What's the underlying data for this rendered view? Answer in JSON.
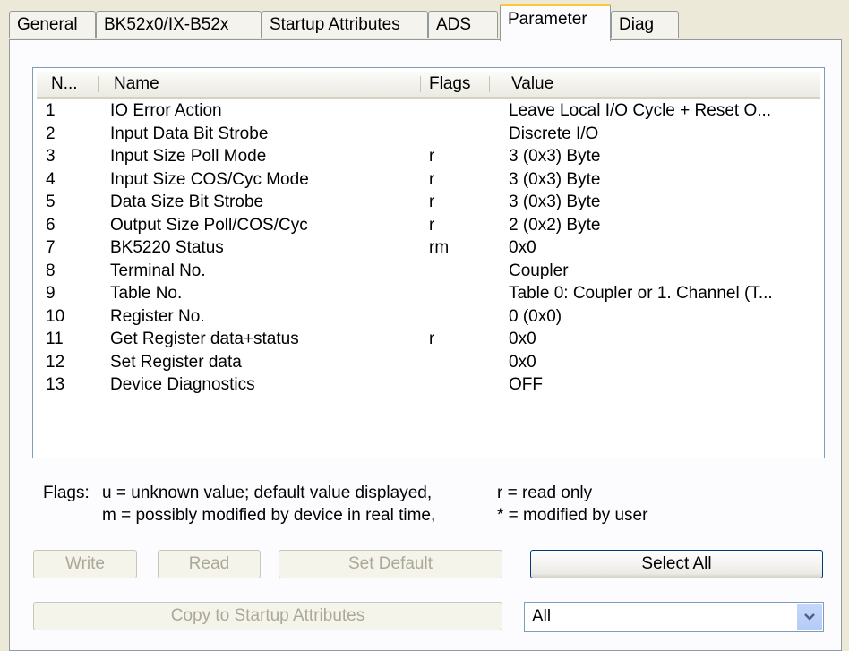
{
  "tabs": [
    "General",
    "BK52x0/IX-B52x",
    "Startup Attributes",
    "ADS",
    "Parameter",
    "Diag"
  ],
  "active_tab": "Parameter",
  "table": {
    "headers": {
      "no": "N...",
      "name": "Name",
      "flags": "Flags",
      "value": "Value"
    },
    "rows": [
      {
        "no": "1",
        "name": "IO Error Action",
        "flags": "",
        "value": "Leave Local I/O Cycle + Reset O..."
      },
      {
        "no": "2",
        "name": "Input Data Bit Strobe",
        "flags": "",
        "value": "Discrete I/O"
      },
      {
        "no": "3",
        "name": "Input Size Poll Mode",
        "flags": "r",
        "value": "3 (0x3) Byte"
      },
      {
        "no": "4",
        "name": "Input Size COS/Cyc Mode",
        "flags": "r",
        "value": "3 (0x3) Byte"
      },
      {
        "no": "5",
        "name": "Data Size Bit Strobe",
        "flags": "r",
        "value": "3 (0x3) Byte"
      },
      {
        "no": "6",
        "name": "Output Size Poll/COS/Cyc",
        "flags": "r",
        "value": "2 (0x2) Byte"
      },
      {
        "no": "7",
        "name": "BK5220 Status",
        "flags": "rm",
        "value": "0x0"
      },
      {
        "no": "8",
        "name": "Terminal No.",
        "flags": "",
        "value": "Coupler"
      },
      {
        "no": "9",
        "name": "Table No.",
        "flags": "",
        "value": "Table 0: Coupler or 1. Channel (T..."
      },
      {
        "no": "10",
        "name": "Register No.",
        "flags": "",
        "value": "0 (0x0)"
      },
      {
        "no": "11",
        "name": "Get Register data+status",
        "flags": "r",
        "value": "0x0"
      },
      {
        "no": "12",
        "name": "Set Register data",
        "flags": "",
        "value": "0x0"
      },
      {
        "no": "13",
        "name": "Device Diagnostics",
        "flags": "",
        "value": "OFF"
      }
    ]
  },
  "legend": {
    "label": "Flags:",
    "line1_left": "u = unknown value; default value displayed,",
    "line1_right": "r = read only",
    "line2_left": "m = possibly modified by device in real time,",
    "line2_right": "* = modified by user"
  },
  "buttons": {
    "write": "Write",
    "read": "Read",
    "set_default": "Set Default",
    "select_all": "Select All",
    "copy_startup": "Copy to Startup Attributes"
  },
  "filter_select": {
    "value": "All"
  },
  "colors": {
    "tab_highlight": "#ffc83c",
    "window_bg": "#ece9d8",
    "panel_bg": "#fcfcfe"
  },
  "icons": {
    "dropdown": "chevron-down-icon"
  }
}
